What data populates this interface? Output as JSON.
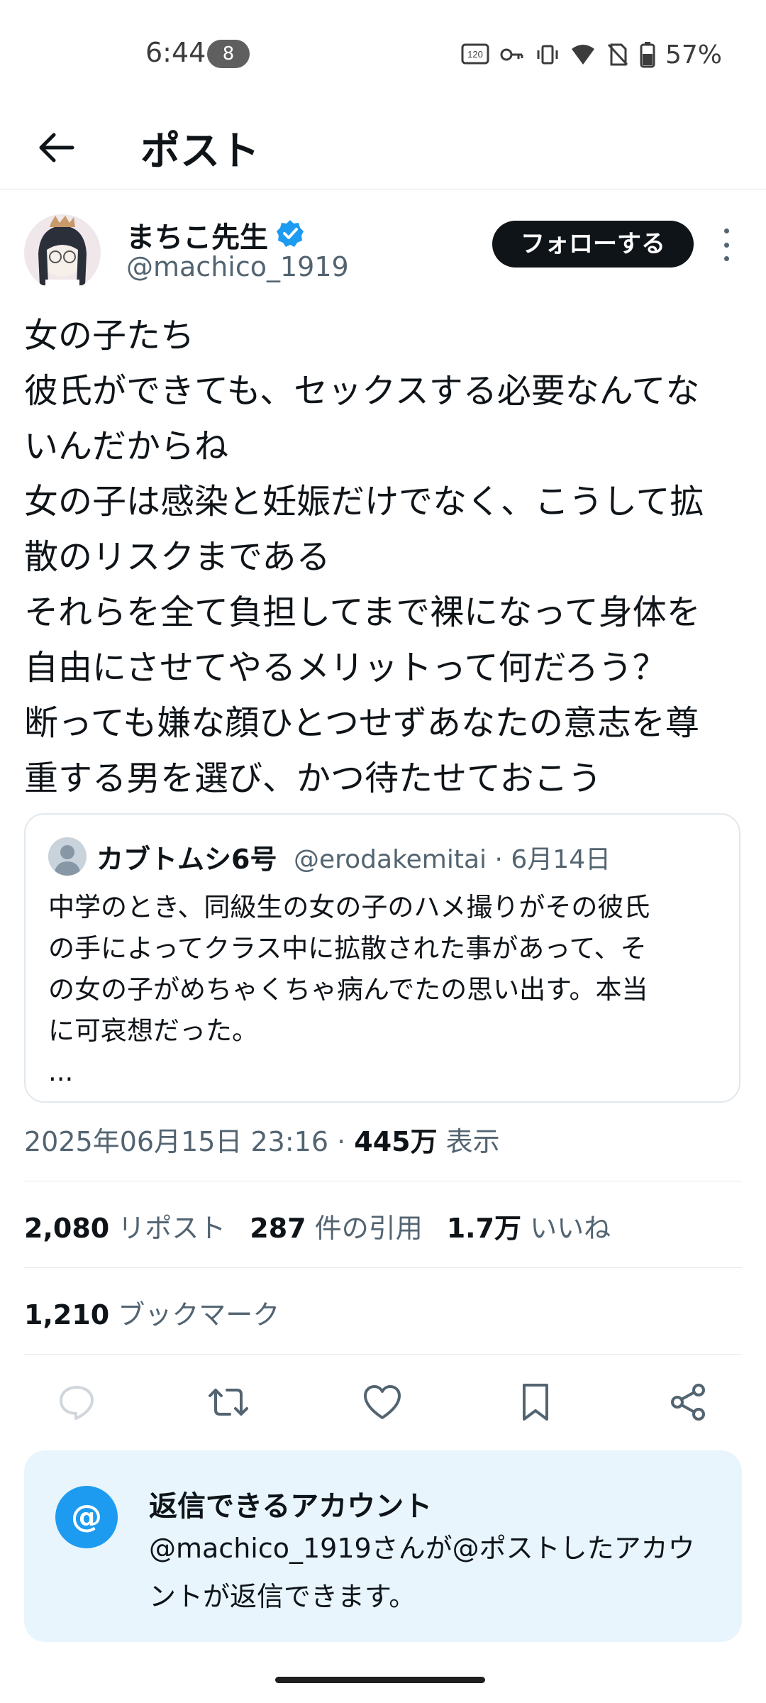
{
  "status_bar": {
    "time": "6:44",
    "notification_count": "8",
    "refresh_badge": "120",
    "battery": "57%"
  },
  "header": {
    "back_icon": "arrow-left-icon",
    "title": "ポスト"
  },
  "author": {
    "name": "まちこ先生",
    "handle": "@machico_1919",
    "verified": true,
    "follow_label": "フォローする"
  },
  "tweet": {
    "lines": [
      "女の子たち",
      "彼氏ができても、セックスする必要なんてな",
      "いんだからね",
      "女の子は感染と妊娠だけでなく、こうして拡",
      "散のリスクまである",
      "それらを全て負担してまで裸になって身体を",
      "自由にさせてやるメリットって何だろう？",
      "断っても嫌な顔ひとつせずあなたの意志を尊",
      "重する男を選び、かつ待たせておこう"
    ]
  },
  "quote": {
    "name": "カブトムシ6号",
    "handle_date": "@erodakemitai · 6月14日",
    "lines": [
      "中学のとき、同級生の女の子のハメ撮りがその彼氏",
      "の手によってクラス中に拡散された事があって、そ",
      "の女の子がめちゃくちゃ病んでたの思い出す。本当",
      "に可哀想だった。",
      "..."
    ]
  },
  "meta": {
    "timestamp": "2025年06月15日 23:16 · ",
    "views_count": "445万",
    "views_label": " 表示"
  },
  "stats": {
    "reposts_count": "2,080",
    "reposts_label": " リポスト",
    "quotes_count": "287",
    "quotes_label": " 件の引用",
    "likes_count": "1.7万",
    "likes_label": " いいね",
    "bookmarks_count": "1,210",
    "bookmarks_label": " ブックマーク"
  },
  "actions": [
    "reply-icon",
    "repost-icon",
    "like-icon",
    "bookmark-icon",
    "share-icon"
  ],
  "reply_restriction": {
    "icon": "@",
    "title": "返信できるアカウント",
    "line1": "@machico_1919さんが@ポストしたアカウ",
    "line2": "ントが返信できます。"
  },
  "colors": {
    "text_primary": "#0f1419",
    "text_secondary": "#536471",
    "accent": "#1d9bf0",
    "reply_card_bg": "#e8f5fd"
  }
}
